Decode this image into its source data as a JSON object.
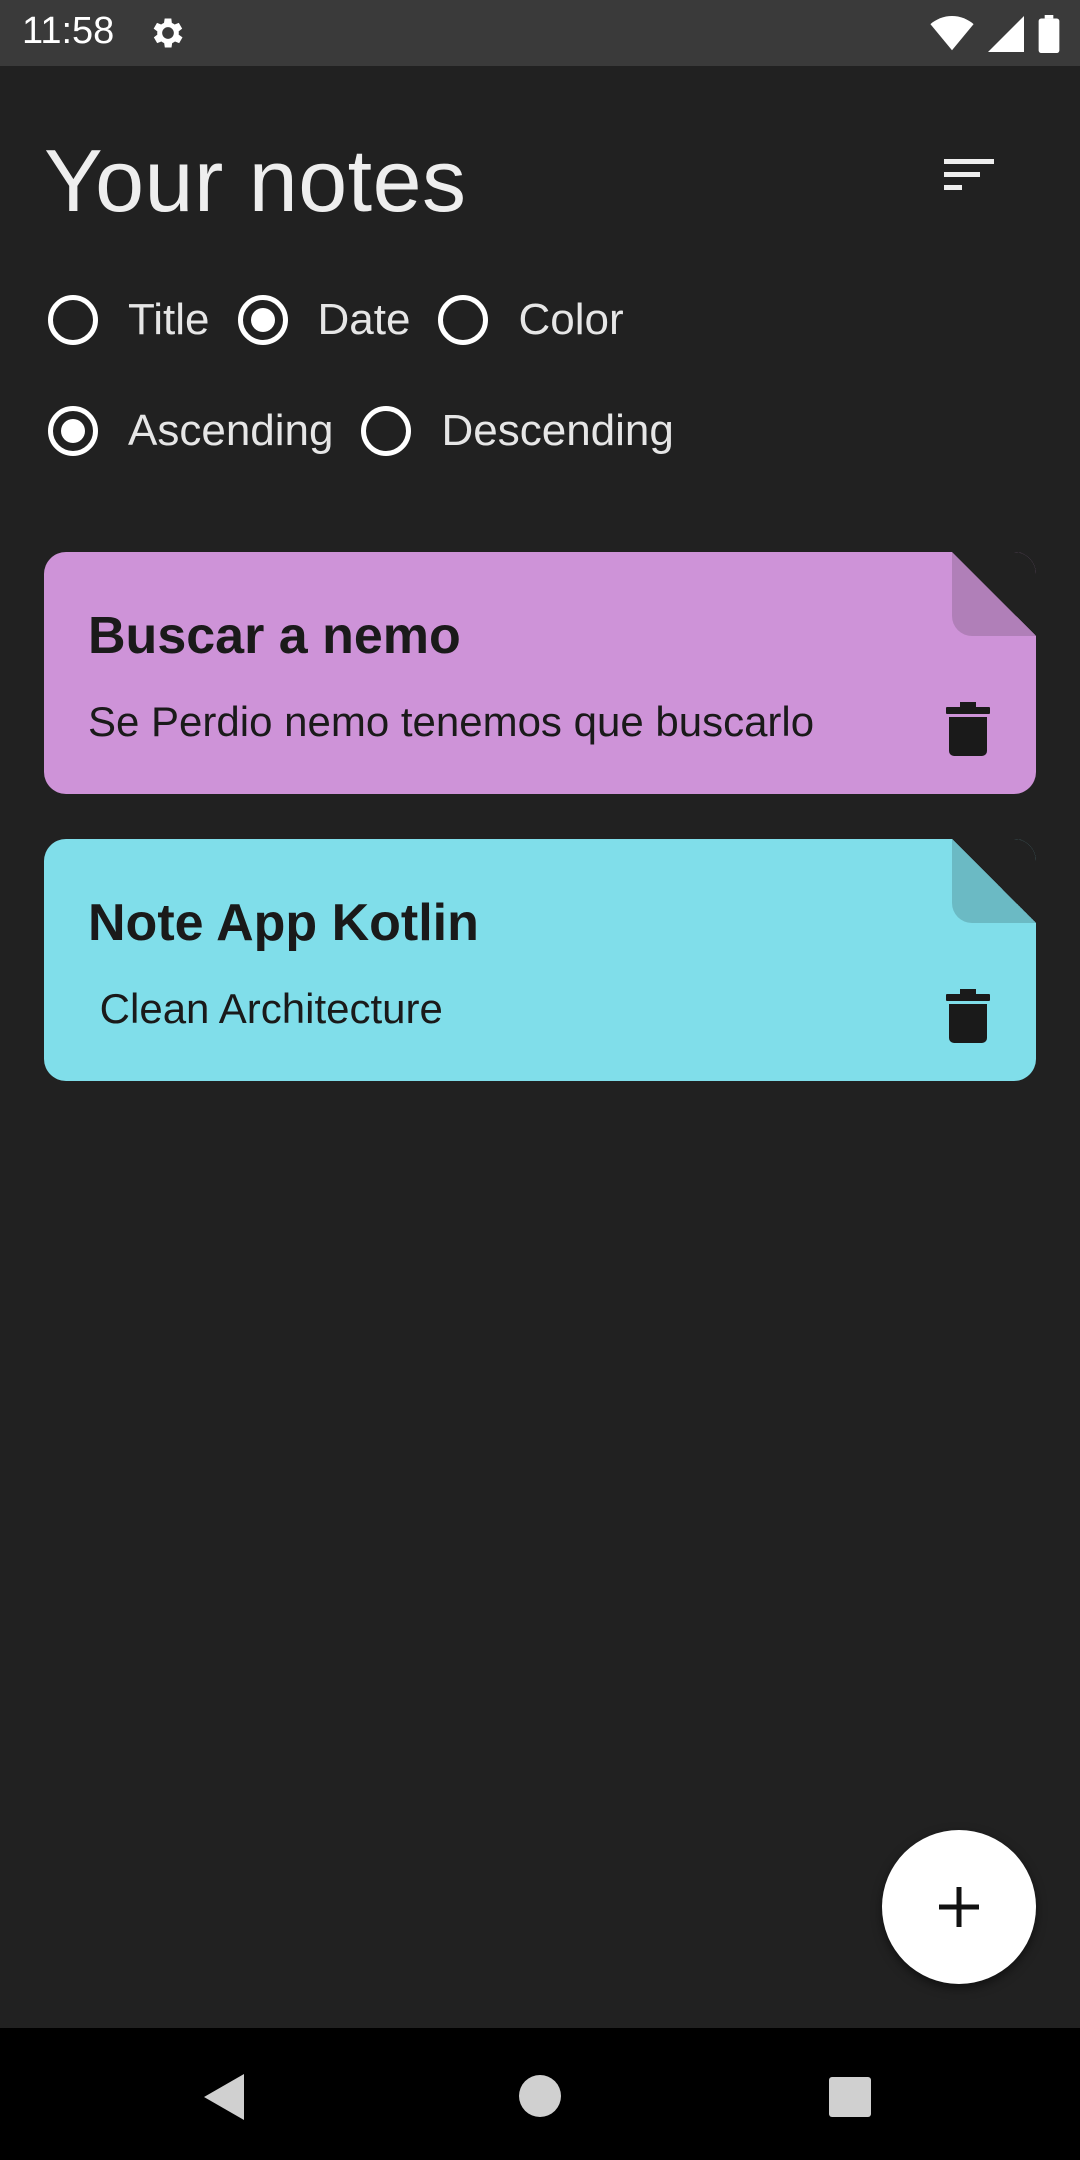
{
  "status_bar": {
    "time": "11:58"
  },
  "header": {
    "title": "Your notes"
  },
  "sort": {
    "order_by": [
      {
        "label": "Title",
        "checked": false
      },
      {
        "label": "Date",
        "checked": true
      },
      {
        "label": "Color",
        "checked": false
      }
    ],
    "direction": [
      {
        "label": "Ascending",
        "checked": true
      },
      {
        "label": "Descending",
        "checked": false
      }
    ]
  },
  "notes": [
    {
      "title": "Buscar a nemo",
      "content": "Se Perdio nemo tenemos que buscarlo",
      "color": "#CE93D8",
      "fold_color": "#B07FB8"
    },
    {
      "title": "Note App Kotlin",
      "content": " Clean Architecture",
      "color": "#80DEEA",
      "fold_color": "#6BBAC4"
    }
  ],
  "colors": {
    "background": "#212121",
    "status_bar": "#3a3a3a",
    "nav_bar": "#000000",
    "fab": "#ffffff"
  }
}
